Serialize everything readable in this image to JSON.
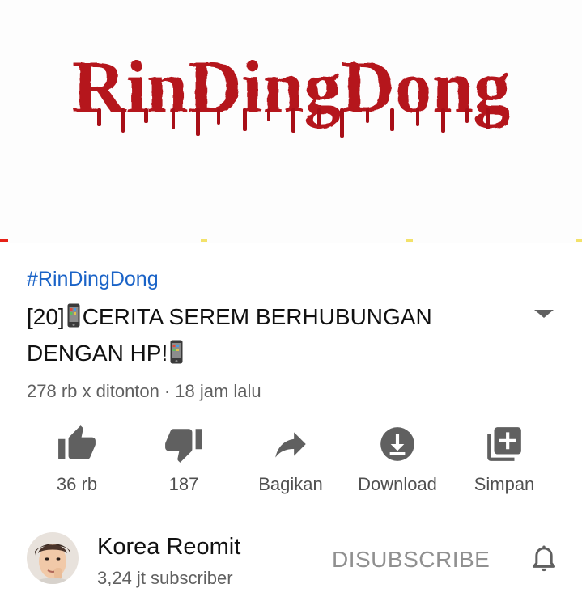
{
  "video": {
    "logo_text": "RinDingDong",
    "hashtag": "#RinDingDong",
    "title_part1": "[20]",
    "title_part2": "CERITA SEREM BERHUBUNGAN DENGAN HP!",
    "views": "278 rb x ditonton",
    "separator": "·",
    "age": "18 jam lalu"
  },
  "actions": {
    "like_count": "36 rb",
    "dislike_count": "187",
    "share_label": "Bagikan",
    "download_label": "Download",
    "save_label": "Simpan"
  },
  "channel": {
    "name": "Korea Reomit",
    "subscribers": "3,24 jt subscriber",
    "subscribe_state_label": "DISUBSCRIBE"
  },
  "colors": {
    "logo_red": "#b5121b",
    "link_blue": "#1a63c7",
    "progress_red": "#e62117",
    "ad_marker_yellow": "#f3e26a",
    "icon_gray": "#606060"
  },
  "icons": [
    "thumbs-up-icon",
    "thumbs-down-icon",
    "share-icon",
    "download-icon",
    "save-playlist-icon",
    "bell-icon",
    "expand-icon",
    "phone-emoji-icon"
  ]
}
